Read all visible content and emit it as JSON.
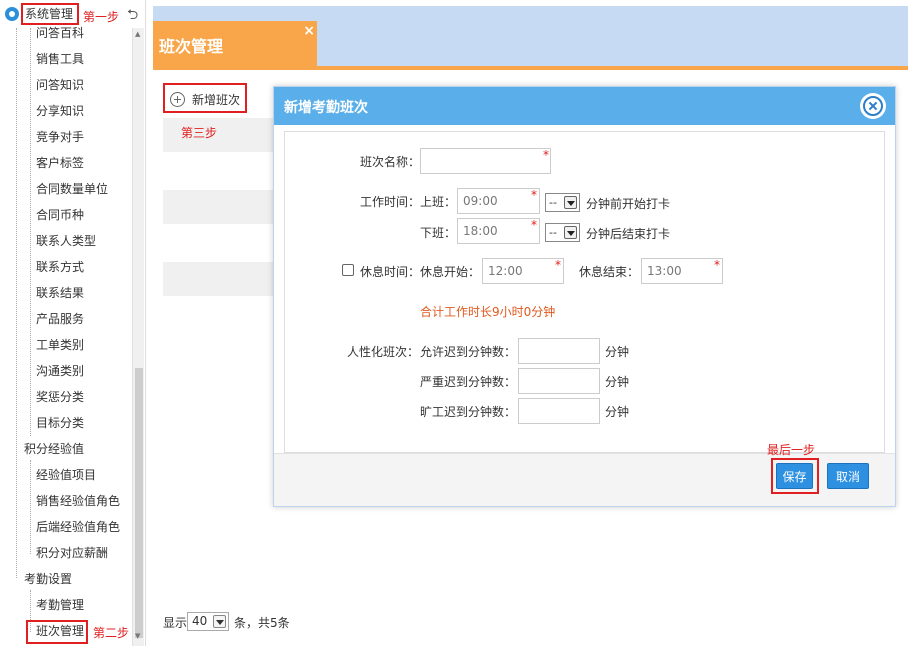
{
  "sidebar": {
    "title": "系统管理",
    "back_icon": "undo-icon",
    "items": [
      {
        "label": "问答百科",
        "level": 2
      },
      {
        "label": "销售工具",
        "level": 2
      },
      {
        "label": "问答知识",
        "level": 2
      },
      {
        "label": "分享知识",
        "level": 2
      },
      {
        "label": "竞争对手",
        "level": 2
      },
      {
        "label": "客户标签",
        "level": 2
      },
      {
        "label": "合同数量单位",
        "level": 2
      },
      {
        "label": "合同币种",
        "level": 2
      },
      {
        "label": "联系人类型",
        "level": 2
      },
      {
        "label": "联系方式",
        "level": 2
      },
      {
        "label": "联系结果",
        "level": 2
      },
      {
        "label": "产品服务",
        "level": 2
      },
      {
        "label": "工单类别",
        "level": 2
      },
      {
        "label": "沟通类别",
        "level": 2
      },
      {
        "label": "奖惩分类",
        "level": 2
      },
      {
        "label": "目标分类",
        "level": 2
      },
      {
        "label": "积分经验值",
        "level": 1
      },
      {
        "label": "经验值项目",
        "level": 2
      },
      {
        "label": "销售经验值角色",
        "level": 2
      },
      {
        "label": "后端经验值角色",
        "level": 2
      },
      {
        "label": "积分对应薪酬",
        "level": 2
      },
      {
        "label": "考勤设置",
        "level": 1
      },
      {
        "label": "考勤管理",
        "level": 2
      },
      {
        "label": "班次管理",
        "level": 2
      }
    ]
  },
  "annotations": {
    "step1": "第一步",
    "step2": "第二步",
    "step3": "第三步",
    "step_last": "最后一步"
  },
  "tab": {
    "label": "班次管理",
    "close": "×"
  },
  "toolbar": {
    "add_label": "新增班次"
  },
  "pager": {
    "prefix": "显示",
    "page_size": "40",
    "suffix": "条，共5条"
  },
  "modal": {
    "title": "新增考勤班次",
    "name_label": "班次名称：",
    "name_value": "",
    "work_time_label": "工作时间：",
    "on_label": "上班：",
    "on_value": "09:00",
    "on_select": "--",
    "on_hint": "分钟前开始打卡",
    "off_label": "下班：",
    "off_value": "18:00",
    "off_select": "--",
    "off_hint": "分钟后结束打卡",
    "rest_label": "休息时间：",
    "rest_start_label": "休息开始：",
    "rest_start_value": "12:00",
    "rest_end_label": "休息结束：",
    "rest_end_value": "13:00",
    "total_text": "合计工作时长9小时0分钟",
    "humane_label": "人性化班次：",
    "late_label": "允许迟到分钟数：",
    "serious_late_label": "严重迟到分钟数：",
    "absent_label": "旷工迟到分钟数：",
    "minute_unit": "分钟",
    "save_label": "保存",
    "cancel_label": "取消",
    "required_mark": "*"
  },
  "colors": {
    "accent_blue": "#5aaeea",
    "tab_orange": "#f9a64a",
    "annotation_red": "#e02020",
    "total_orange": "#e0591e"
  }
}
